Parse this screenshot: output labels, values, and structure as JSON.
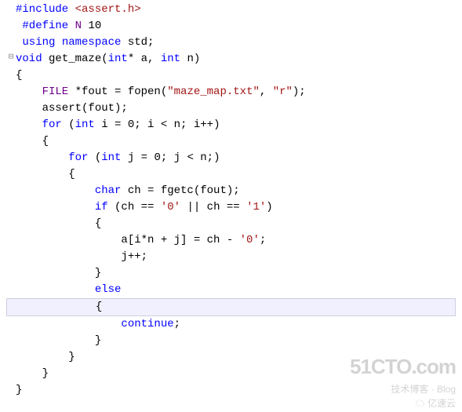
{
  "code": {
    "l1_pre": "#include",
    "l1_path": " <assert.h>",
    "l2_pre": " #define ",
    "l2_name": "N",
    "l2_val": " 10",
    "l3_kw1": " using",
    "l3_kw2": " namespace",
    "l3_id": " std;",
    "l4_type": "void",
    "l4_fn": " get_maze(",
    "l4_p1t": "int",
    "l4_p1": "* a, ",
    "l4_p2t": "int",
    "l4_p2": " n)",
    "l5": "{",
    "l6a": "    FILE",
    "l6b": " *fout = fopen(",
    "l6s1": "\"maze_map.txt\"",
    "l6c": ", ",
    "l6s2": "\"r\"",
    "l6d": ");",
    "l7": "    assert(fout);",
    "l8kw": "    for",
    "l8a": " (",
    "l8t": "int",
    "l8b": " i = 0; i < n; i++)",
    "l9": "    {",
    "l10kw": "        for",
    "l10a": " (",
    "l10t": "int",
    "l10b": " j = 0; j < n;)",
    "l11": "        {",
    "l12t": "            char",
    "l12a": " ch = fgetc(fout);",
    "l13kw": "            if",
    "l13a": " (ch == ",
    "l13c1": "'0'",
    "l13b": " || ch == ",
    "l13c2": "'1'",
    "l13c": ")",
    "l14": "            {",
    "l15a": "                a[i*n + j] = ch - ",
    "l15c": "'0'",
    "l15b": ";",
    "l16": "                j++;",
    "l17": "            }",
    "l18kw": "            else",
    "l19": "            {",
    "l20kw": "                continue",
    "l20a": ";",
    "l21": "            }",
    "l22": "        }",
    "l23": "    }",
    "l24": "}"
  },
  "gutter": {
    "collapse": "⊟"
  },
  "watermark": {
    "main": "51CTO.com",
    "sub": "技术博客 · Blog",
    "cloud": "亿速云"
  }
}
